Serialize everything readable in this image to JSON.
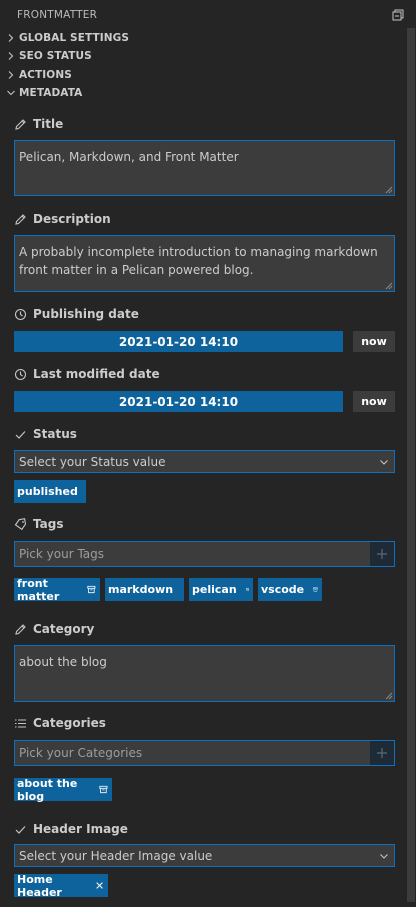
{
  "panel": {
    "title": "FRONTMATTER",
    "collapse_icon": "collapse-all-icon"
  },
  "sections": [
    {
      "label": "GLOBAL SETTINGS",
      "expanded": false
    },
    {
      "label": "SEO STATUS",
      "expanded": false
    },
    {
      "label": "ACTIONS",
      "expanded": false
    },
    {
      "label": "METADATA",
      "expanded": true
    }
  ],
  "metadata": {
    "title": {
      "label": "Title",
      "icon": "pencil-icon",
      "value": "Pelican, Markdown, and Front Matter"
    },
    "description": {
      "label": "Description",
      "icon": "pencil-icon",
      "value": "A probably incomplete introduction to managing markdown front matter in a Pelican powered blog."
    },
    "publishing_date": {
      "label": "Publishing date",
      "icon": "clock-icon",
      "value": "2021-01-20 14:10",
      "now_label": "now"
    },
    "last_modified_date": {
      "label": "Last modified date",
      "icon": "clock-icon",
      "value": "2021-01-20 14:10",
      "now_label": "now"
    },
    "status": {
      "label": "Status",
      "icon": "check-icon",
      "placeholder": "Select your Status value",
      "chips": [
        "published"
      ]
    },
    "tags": {
      "label": "Tags",
      "icon": "tag-icon",
      "placeholder": "Pick your Tags",
      "chips": [
        "front matter",
        "markdown",
        "pelican",
        "vscode"
      ]
    },
    "category": {
      "label": "Category",
      "icon": "pencil-icon",
      "value": "about the blog"
    },
    "categories": {
      "label": "Categories",
      "icon": "list-icon",
      "placeholder": "Pick your Categories",
      "chips": [
        "about the blog"
      ]
    },
    "header_image": {
      "label": "Header Image",
      "icon": "check-icon",
      "placeholder": "Select your Header Image value",
      "chips": [
        "Home Header"
      ]
    }
  },
  "colors": {
    "background": "#252526",
    "accent": "#0e639c",
    "input_background": "#3c3c3c",
    "focus_border": "#0e70c0"
  }
}
